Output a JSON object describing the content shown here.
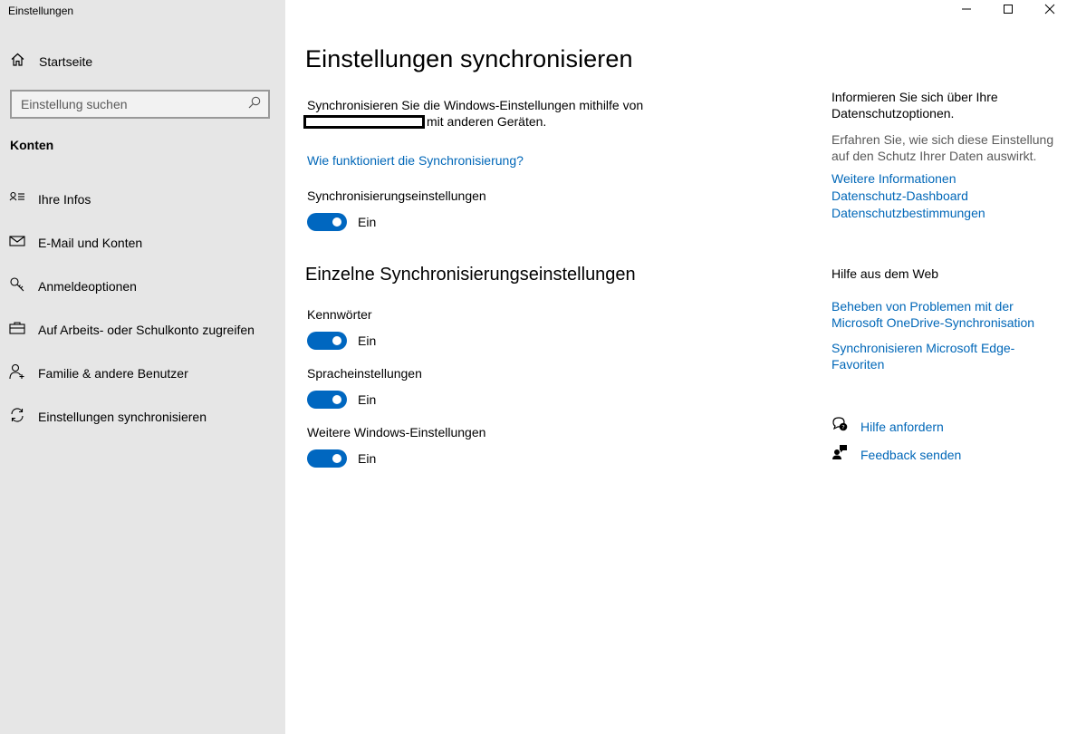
{
  "window": {
    "title": "Einstellungen",
    "controls": {
      "minimize_icon": "minimize-icon",
      "maximize_icon": "maximize-icon",
      "close_icon": "close-icon"
    }
  },
  "sidebar": {
    "home_label": "Startseite",
    "search_placeholder": "Einstellung suchen",
    "section_label": "Konten",
    "items": [
      {
        "label": "Ihre Infos",
        "icon": "contact-card-icon"
      },
      {
        "label": "E-Mail und Konten",
        "icon": "mail-icon"
      },
      {
        "label": "Anmeldeoptionen",
        "icon": "key-icon"
      },
      {
        "label": "Auf Arbeits- oder Schulkonto zugreifen",
        "icon": "briefcase-icon"
      },
      {
        "label": "Familie & andere Benutzer",
        "icon": "person-add-icon"
      },
      {
        "label": "Einstellungen synchronisieren",
        "icon": "sync-icon"
      }
    ]
  },
  "main": {
    "title": "Einstellungen synchronisieren",
    "description_part1": "Synchronisieren Sie die Windows-Einstellungen mithilfe von",
    "description_part2": "mit anderen Geräten.",
    "how_link": "Wie funktioniert die Synchronisierung?",
    "sync_settings": {
      "label": "Synchronisierungseinstellungen",
      "state": "Ein",
      "on": true
    },
    "individual_title": "Einzelne Synchronisierungseinstellungen",
    "individual": [
      {
        "label": "Kennwörter",
        "state": "Ein",
        "on": true
      },
      {
        "label": "Spracheinstellungen",
        "state": "Ein",
        "on": true
      },
      {
        "label": "Weitere Windows-Einstellungen",
        "state": "Ein",
        "on": true
      }
    ]
  },
  "right": {
    "privacy_heading": "Informieren Sie sich über Ihre Datenschutzoptionen.",
    "privacy_text": "Erfahren Sie, wie sich diese Einstellung auf den Schutz Ihrer Daten auswirkt.",
    "privacy_links": [
      "Weitere Informationen",
      "Datenschutz-Dashboard",
      "Datenschutzbestimmungen"
    ],
    "web_help_heading": "Hilfe aus dem Web",
    "web_links": [
      "Beheben von Problemen mit der Microsoft OneDrive-Synchronisation",
      "Synchronisieren Microsoft Edge-Favoriten"
    ],
    "get_help": "Hilfe anfordern",
    "feedback": "Feedback senden"
  },
  "colors": {
    "accent": "#0067c0",
    "link": "#0067b8",
    "sidebar_bg": "#e6e6e6"
  }
}
